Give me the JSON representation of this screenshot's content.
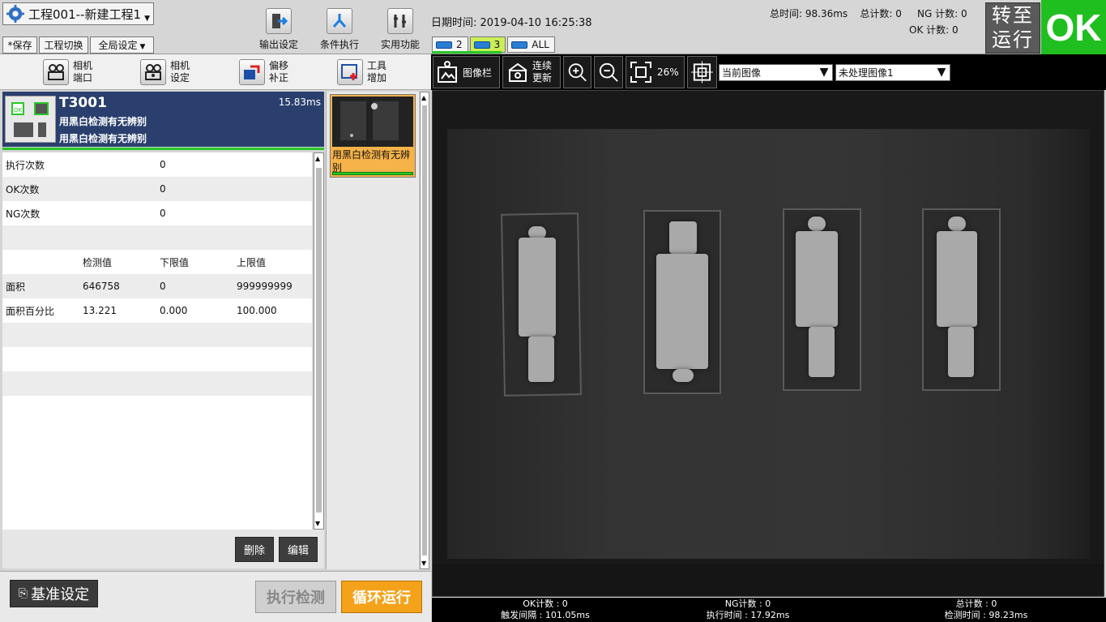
{
  "app": {
    "project_title": "工程001--新建工程1",
    "menu": {
      "save": "*保存",
      "switch_project": "工程切换",
      "global_settings": "全局设定"
    },
    "tools": {
      "output_settings": "输出设定",
      "condition_exec": "条件执行",
      "utilities": "实用功能"
    },
    "datetime": "日期时间: 2019-04-10 16:25:38",
    "camera_tabs": [
      "2",
      "3",
      "ALL"
    ],
    "totals": {
      "total_time": "总时间:  98.36ms",
      "total_count": "总计数: 0",
      "ng_count": "NG 计数: 0",
      "ok_count": "OK 计数: 0"
    },
    "switch_run": "转至运行",
    "ok_badge": "OK"
  },
  "left_toolbar": [
    {
      "l1": "相机",
      "l2": "端口"
    },
    {
      "l1": "相机",
      "l2": "设定"
    },
    {
      "l1": "偏移",
      "l2": "补正"
    },
    {
      "l1": "工具",
      "l2": "增加"
    }
  ],
  "tool": {
    "id": "T3001",
    "time": "15.83ms",
    "desc1": "用黑白检测有无辨别",
    "desc2": "用黑白检测有无辨别",
    "ok_badge": "OK"
  },
  "stats": [
    {
      "label": "执行次数",
      "value": "0"
    },
    {
      "label": "OK次数",
      "value": "0"
    },
    {
      "label": "NG次数",
      "value": "0"
    }
  ],
  "measure": {
    "headers": [
      "",
      "检测值",
      "下限值",
      "上限值"
    ],
    "rows": [
      [
        "面积",
        "646758",
        "0",
        "999999999"
      ],
      [
        "面积百分比",
        "13.221",
        "0.000",
        "100.000"
      ]
    ]
  },
  "buttons": {
    "delete": "删除",
    "edit": "编辑",
    "base_settings": "基准设定",
    "exec_detect": "执行检测",
    "loop_run": "循环运行"
  },
  "thumbnail": {
    "label": "用黑白检测有无辨别"
  },
  "image_toolbar": {
    "image_bar": "图像栏",
    "continuous_l1": "连续",
    "continuous_l2": "更新",
    "zoom": "26%",
    "current_image": "当前图像",
    "unprocessed_image": "未处理图像1"
  },
  "status_strip": {
    "ok_count": "OK计数 : 0",
    "trigger_interval": "触发间隔 : 101.05ms",
    "ng_count": "NG计数 : 0",
    "exec_time": "执行时间 : 17.92ms",
    "total_count": "总计数 : 0",
    "detect_time": "检测时间 : 98.23ms"
  },
  "colors": {
    "ok_green": "#1fbf1f",
    "header_navy": "#2a3f6d",
    "loop_orange": "#f4a21a"
  }
}
